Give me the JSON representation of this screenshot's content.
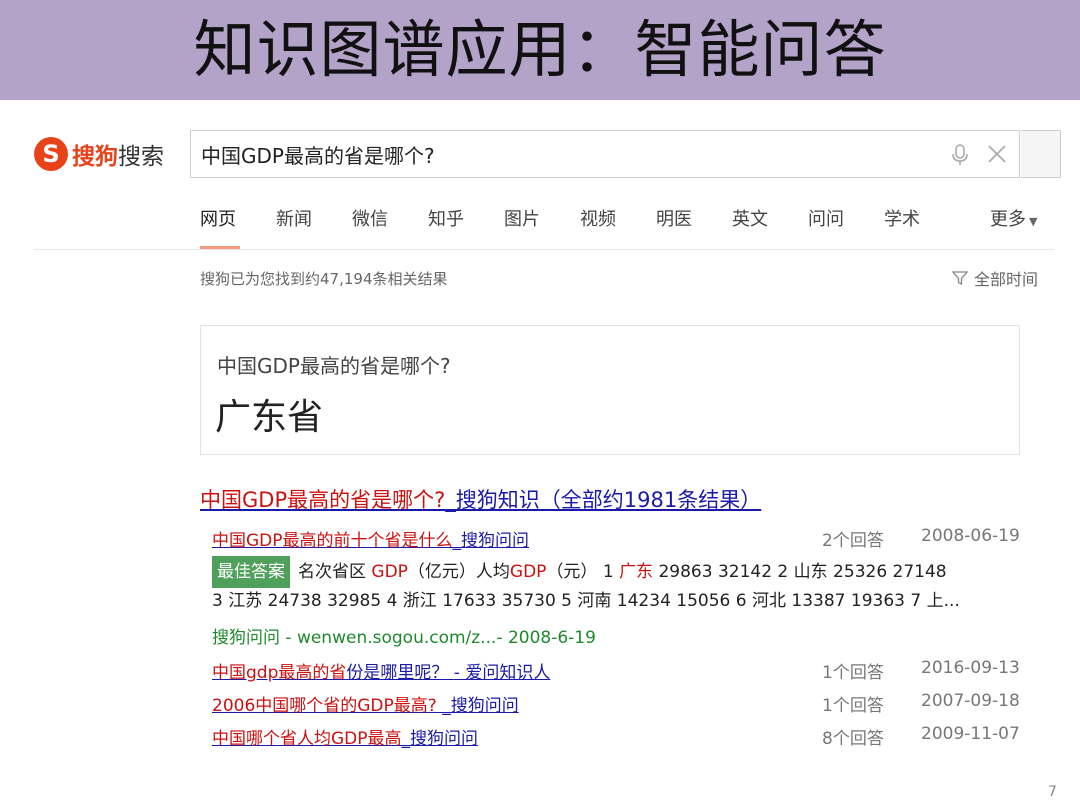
{
  "slide_title": "知识图谱应用：智能问答",
  "brand": {
    "mark": "S",
    "name_part1": "搜狗",
    "name_part2": "搜索",
    "color": "#e8421b"
  },
  "search": {
    "query": "中国GDP最高的省是哪个?"
  },
  "tabs": [
    {
      "label": "网页",
      "active": true
    },
    {
      "label": "新闻"
    },
    {
      "label": "微信"
    },
    {
      "label": "知乎"
    },
    {
      "label": "图片"
    },
    {
      "label": "视频"
    },
    {
      "label": "明医"
    },
    {
      "label": "英文"
    },
    {
      "label": "问问"
    },
    {
      "label": "学术"
    }
  ],
  "more_tab": "更多",
  "result_count": "搜狗已为您找到约47,194条相关结果",
  "time_filter": "全部时间",
  "answer_card": {
    "question": "中国GDP最高的省是哪个?",
    "answer": "广东省"
  },
  "main_result": {
    "red_part": "中国GDP最高的省是哪个?",
    "blue_part": "_搜狗知识（全部约1981条结果）"
  },
  "sub_results": [
    {
      "title_red": "中国GDP最高的前十个省是什么",
      "title_blue": "_搜狗问问",
      "answers": "2个回答",
      "date": "2008-06-19"
    },
    {
      "title_red": "中国gdp最高的省",
      "title_blue": "份是哪里呢？ - 爱问知识人",
      "answers": "1个回答",
      "date": "2016-09-13"
    },
    {
      "title_red": "2006中国哪个省的GDP最高?",
      "title_blue": " _搜狗问问",
      "answers": "1个回答",
      "date": "2007-09-18"
    },
    {
      "title_red": "中国哪个省人均GDP最高",
      "title_blue": "_搜狗问问",
      "answers": "8个回答",
      "date": "2009-11-07"
    }
  ],
  "best_answer": {
    "badge": "最佳答案",
    "seg1": "名次省区 ",
    "gdp1": "GDP",
    "seg2": "（亿元）人均",
    "gdp2": "GDP",
    "seg3": "（元） 1 ",
    "gd": "广东",
    "seg4": " 29863 32142 2 山东 25326 27148",
    "line2": "3 江苏 24738 32985 4 浙江 17633 35730 5 河南 14234 15056 6 河北 13387 19363 7 上...",
    "source": "搜狗问问 - wenwen.sogou.com/z...- 2008-6-19"
  },
  "page_number": "7"
}
